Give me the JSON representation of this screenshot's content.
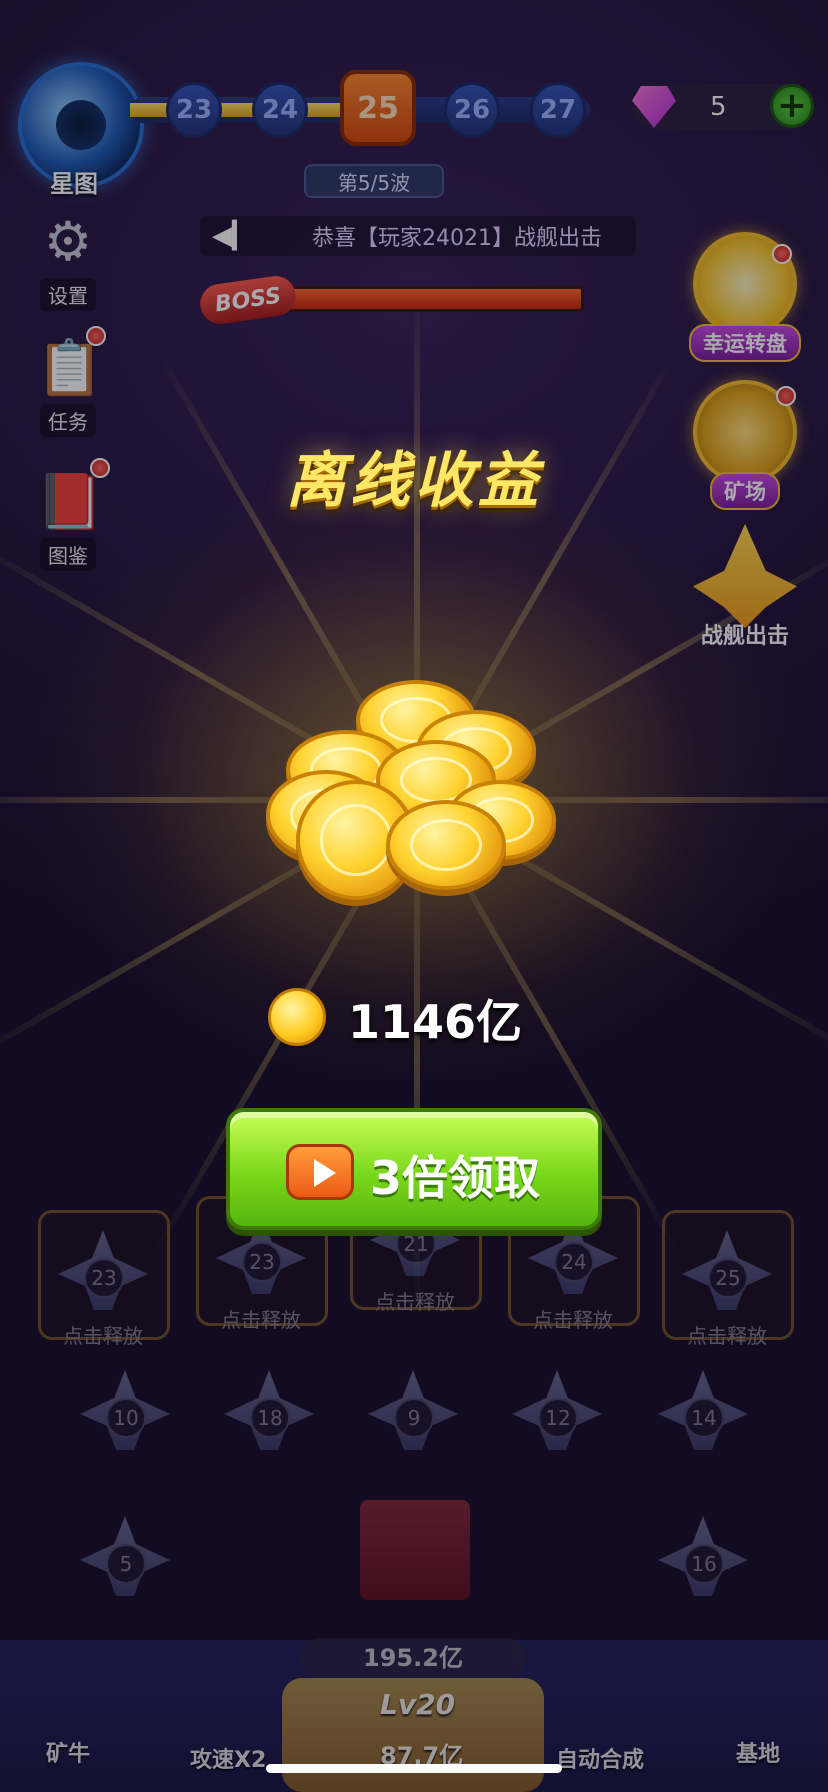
{
  "top_bar": {
    "planet_label": "星图",
    "levels": [
      "23",
      "24",
      "25",
      "26",
      "27"
    ],
    "current_level": "25",
    "wave_label": "第5/5波",
    "gem_count": "5",
    "add_label": "+"
  },
  "ticker": {
    "text": "恭喜【玩家24021】战舰出击"
  },
  "boss": {
    "tag": "BOSS",
    "hp_fraction": 1.0
  },
  "left_menu": [
    {
      "label": "设置",
      "icon": "gear-icon"
    },
    {
      "label": "任务",
      "icon": "clipboard-icon"
    },
    {
      "label": "图鉴",
      "icon": "book-icon"
    }
  ],
  "right_menu": [
    {
      "label": "幸运转盘",
      "icon": "wheel-icon"
    },
    {
      "label": "矿场",
      "icon": "mine-icon"
    },
    {
      "label": "战舰出击",
      "icon": "ship-icon"
    }
  ],
  "dialog": {
    "title": "离线收益",
    "reward_amount": "1146亿",
    "claim_label": "3倍领取"
  },
  "grid": {
    "release_label": "点击释放",
    "top_row": [
      "23",
      "23",
      "21",
      "24",
      "25"
    ],
    "row2": [
      "10",
      "18",
      "9",
      "12",
      "14"
    ],
    "row3": [
      "5",
      "16"
    ]
  },
  "bottom": {
    "coins_total": "195.2亿",
    "level": "Lv20",
    "upgrade_cost": "87.7亿",
    "items": [
      "矿牛",
      "攻速X2",
      "自动合成",
      "基地"
    ]
  },
  "colors": {
    "accent_gold": "#ffe766",
    "button_green": "#7ad81b",
    "level_orange": "#ff8a2b"
  }
}
